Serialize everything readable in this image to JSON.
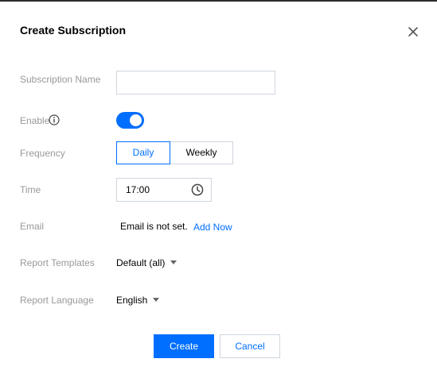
{
  "dialog": {
    "title": "Create Subscription"
  },
  "form": {
    "subscription_name": {
      "label": "Subscription Name",
      "value": ""
    },
    "enable": {
      "label": "Enable",
      "on": true
    },
    "frequency": {
      "label": "Frequency",
      "options": [
        "Daily",
        "Weekly"
      ],
      "selected": "Daily"
    },
    "time": {
      "label": "Time",
      "value": "17:00"
    },
    "email": {
      "label": "Email",
      "status_text": "Email is not set.",
      "action_label": "Add Now"
    },
    "report_templates": {
      "label": "Report Templates",
      "selected": "Default (all)"
    },
    "report_language": {
      "label": "Report Language",
      "selected": "English"
    }
  },
  "footer": {
    "create_label": "Create",
    "cancel_label": "Cancel"
  },
  "colors": {
    "accent": "#006eff",
    "label": "#999999",
    "border": "#cfd5de"
  },
  "icons": [
    "close-icon",
    "info-icon",
    "clock-icon",
    "caret-down-icon"
  ]
}
